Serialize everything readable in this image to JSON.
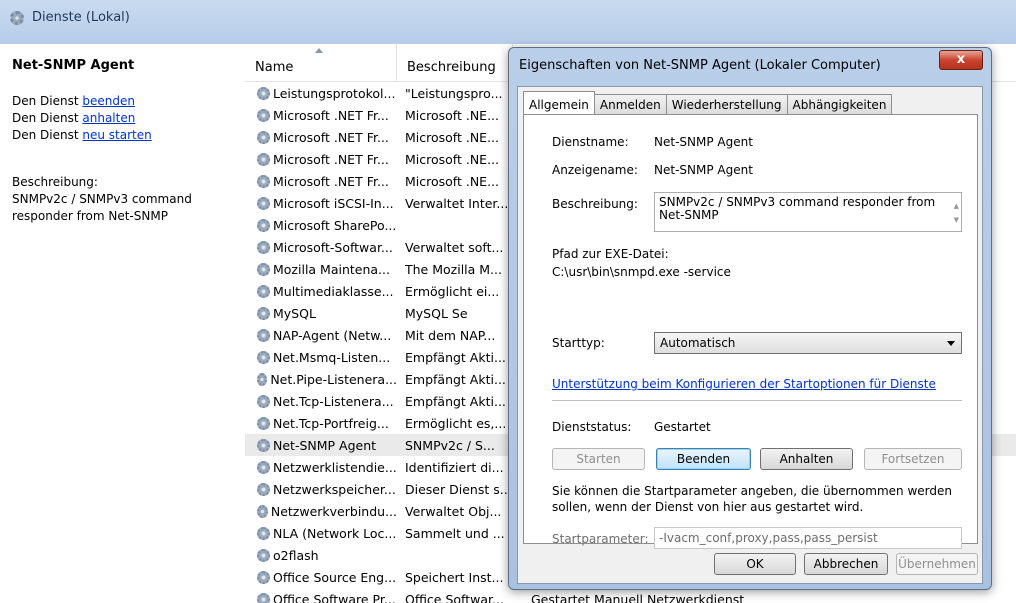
{
  "header": {
    "title": "Dienste (Lokal)"
  },
  "left": {
    "service_name": "Net-SNMP Agent",
    "action1_prefix": "Den Dienst ",
    "action1_link": "beenden",
    "action2_prefix": "Den Dienst ",
    "action2_link": "anhalten",
    "action3_prefix": "Den Dienst ",
    "action3_link": "neu starten",
    "desc_label": "Beschreibung:",
    "desc_line1": "SNMPv2c / SNMPv3 command",
    "desc_line2": "responder from Net-SNMP"
  },
  "list": {
    "col_name": "Name",
    "col_desc": "Beschreibung",
    "rows": [
      {
        "name": "Leistungsprotokol...",
        "desc": "\"Leistungspro...",
        "tail": ""
      },
      {
        "name": "Microsoft .NET Fr...",
        "desc": "Microsoft .NE...",
        "tail": ""
      },
      {
        "name": "Microsoft .NET Fr...",
        "desc": "Microsoft .NE...",
        "tail": ""
      },
      {
        "name": "Microsoft .NET Fr...",
        "desc": "Microsoft .NE...",
        "tail": ""
      },
      {
        "name": "Microsoft .NET Fr...",
        "desc": "Microsoft .NE...",
        "tail": ""
      },
      {
        "name": "Microsoft iSCSI-In...",
        "desc": "Verwaltet Inter...",
        "tail": ""
      },
      {
        "name": "Microsoft SharePo...",
        "desc": "",
        "tail": ""
      },
      {
        "name": "Microsoft-Softwar...",
        "desc": "Verwaltet soft...",
        "tail": ""
      },
      {
        "name": "Mozilla Maintena...",
        "desc": "The Mozilla M...",
        "tail": ""
      },
      {
        "name": "Multimediaklasse...",
        "desc": "Ermöglicht ei...",
        "tail": ""
      },
      {
        "name": "MySQL",
        "desc": "MySQL Se",
        "tail": ""
      },
      {
        "name": "NAP-Agent (Netw...",
        "desc": "Mit dem NAP...",
        "tail": ""
      },
      {
        "name": "Net.Msmq-Listen...",
        "desc": "Empfängt Akti...",
        "tail": ""
      },
      {
        "name": "Net.Pipe-Listenera...",
        "desc": "Empfängt Akti...",
        "tail": ""
      },
      {
        "name": "Net.Tcp-Listenera...",
        "desc": "Empfängt Akti...",
        "tail": ""
      },
      {
        "name": "Net.Tcp-Portfreig...",
        "desc": "Ermöglicht es,...",
        "tail": ""
      },
      {
        "name": "Net-SNMP Agent",
        "desc": "SNMPv2c / S...",
        "tail": ""
      },
      {
        "name": "Netzwerklistendie...",
        "desc": "Identifiziert di...",
        "tail": ""
      },
      {
        "name": "Netzwerkspeicher...",
        "desc": "Dieser Dienst s...",
        "tail": ""
      },
      {
        "name": "Netzwerkverbindu...",
        "desc": "Verwaltet Obj...",
        "tail": ""
      },
      {
        "name": "NLA (Network Loc...",
        "desc": "Sammelt und ...",
        "tail": ""
      },
      {
        "name": "o2flash",
        "desc": "",
        "tail": ""
      },
      {
        "name": "Office  Source Eng...",
        "desc": "Speichert Inst...",
        "tail": ""
      },
      {
        "name": "Office Software Pr...",
        "desc": "Office Softwar...",
        "tail": "Gestartet    Manuell    Netzwerkdienst"
      }
    ]
  },
  "dialog": {
    "title": "Eigenschaften von Net-SNMP Agent (Lokaler Computer)",
    "close": "x",
    "tabs": [
      "Allgemein",
      "Anmelden",
      "Wiederherstellung",
      "Abhängigkeiten"
    ],
    "dienstname_label": "Dienstname:",
    "dienstname_value": "Net-SNMP Agent",
    "anzeigename_label": "Anzeigename:",
    "anzeigename_value": "Net-SNMP Agent",
    "beschreibung_label": "Beschreibung:",
    "beschreibung_line1": "SNMPv2c / SNMPv3 command responder from",
    "beschreibung_line2": "Net-SNMP",
    "pfad_label": "Pfad zur EXE-Datei:",
    "pfad_value": "C:\\usr\\bin\\snmpd.exe -service",
    "starttyp_label": "Starttyp:",
    "starttyp_value": "Automatisch",
    "help_link": "Unterstützung beim Konfigurieren der Startoptionen für Dienste",
    "status_label": "Dienststatus:",
    "status_value": "Gestartet",
    "btn_start": "Starten",
    "btn_stop": "Beenden",
    "btn_pause": "Anhalten",
    "btn_resume": "Fortsetzen",
    "info_text": "Sie können die Startparameter angeben, die übernommen werden sollen, wenn der Dienst von hier aus gestartet wird.",
    "startparam_label": "Startparameter:",
    "startparam_value": "-Ivacm_conf,proxy,pass,pass_persist",
    "btn_ok": "OK",
    "btn_cancel": "Abbrechen",
    "btn_apply": "Übernehmen"
  }
}
